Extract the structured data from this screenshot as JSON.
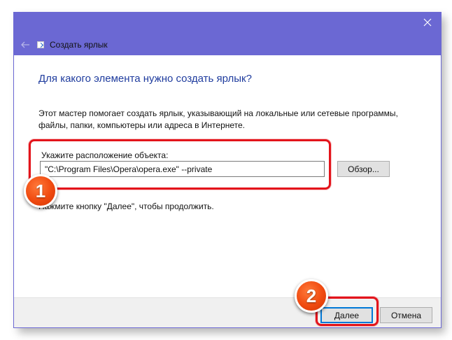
{
  "window": {
    "title": "Создать ярлык"
  },
  "wizard": {
    "heading": "Для какого элемента нужно создать ярлык?",
    "description": "Этот мастер помогает создать ярлык, указывающий на локальные или сетевые программы, файлы, папки, компьютеры или адреса в Интернете.",
    "location_label": "Укажите расположение объекта:",
    "location_value": "\"C:\\Program Files\\Opera\\opera.exe\" --private",
    "browse_label": "Обзор...",
    "hint": "Нажмите кнопку \"Далее\", чтобы продолжить."
  },
  "footer": {
    "next_label": "Далее",
    "cancel_label": "Отмена"
  },
  "annotations": {
    "badge_1": "1",
    "badge_2": "2"
  },
  "colors": {
    "titlebar": "#6b68d3",
    "heading": "#1f3c9e",
    "highlight": "#e3141b",
    "badge": "#f04a10",
    "default_button_border": "#0078d7"
  },
  "icons": {
    "close": "close-icon",
    "back": "back-arrow-icon",
    "wizard": "shortcut-wizard-icon"
  }
}
